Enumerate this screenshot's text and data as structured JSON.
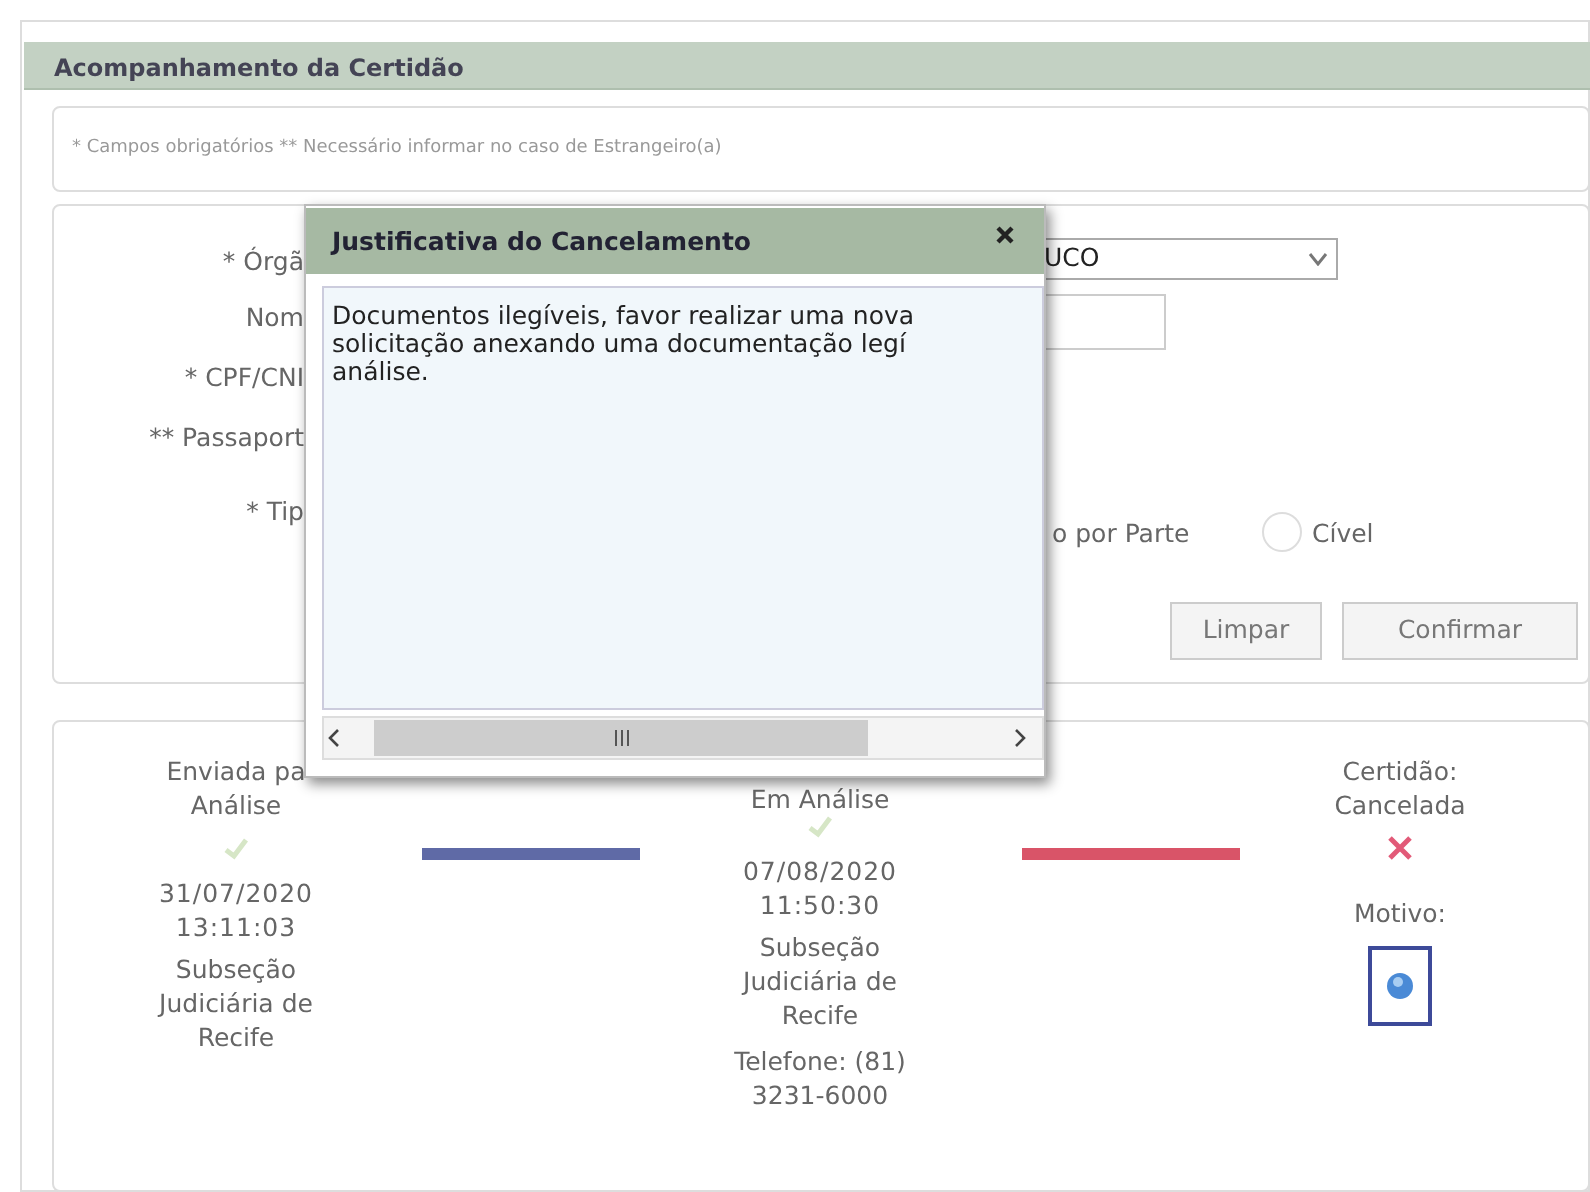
{
  "panel": {
    "title": "Acompanhamento da Certidão",
    "note": "* Campos obrigatórios ** Necessário informar no caso de Estrangeiro(a)"
  },
  "form": {
    "labels": [
      "* Órgã",
      "Nom",
      "* CPF/CNI",
      "** Passaport",
      "* Tip"
    ],
    "orgao_select": {
      "value": "UCO"
    },
    "tipo_option_partial": "o por Parte",
    "civel_radio": {
      "label": "Cível",
      "selected": false
    },
    "buttons": [
      "Limpar",
      "Confirmar"
    ]
  },
  "timeline": {
    "steps": [
      {
        "kind": "done",
        "title": [
          "Enviada pa",
          "Análise"
        ],
        "lines": [
          "31/07/2020",
          "13:11:03"
        ],
        "place": [
          "Subseção",
          "Judiciária de",
          "Recife"
        ]
      },
      {
        "kind": "done",
        "title": [
          "Em Análise"
        ],
        "lines": [
          "07/08/2020",
          "11:50:30"
        ],
        "place": [
          "Subseção",
          "Judiciária de",
          "Recife"
        ],
        "phone": [
          "Telefone: (81)",
          "3231-6000"
        ]
      },
      {
        "kind": "cancelled",
        "title": [
          "Certidão:",
          "Cancelada"
        ],
        "reason_label": "Motivo:"
      }
    ],
    "connectors": [
      {
        "color": "#5f6aa6"
      },
      {
        "color": "#d95468"
      }
    ]
  },
  "modal": {
    "title": "Justificativa do Cancelamento",
    "lines": [
      "Documentos ilegíveis, favor realizar uma nova",
      "solicitação anexando uma documentação legí",
      "análise."
    ]
  }
}
